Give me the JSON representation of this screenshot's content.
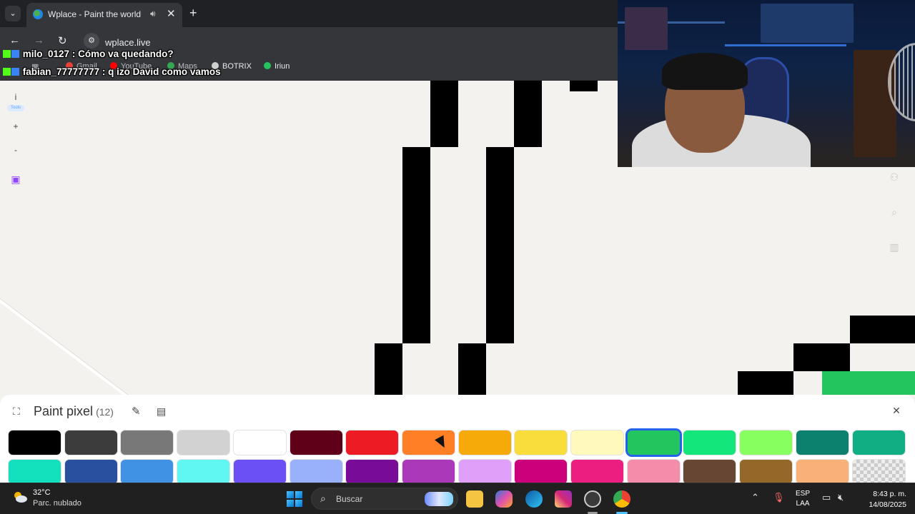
{
  "browser": {
    "tab_title": "Wplace - Paint the world",
    "tab_close": "✕",
    "new_tab": "+",
    "url": "wplace.live",
    "bookmarks": [
      "Gmail",
      "YouTube",
      "Maps",
      "BOTRIX",
      "Iriun"
    ]
  },
  "chat": [
    {
      "user": "milo_0127",
      "message": ": Cómo va quedando?"
    },
    {
      "user": "fabian_77777777",
      "message": ": q izo David como vamos"
    }
  ],
  "tools": {
    "info": "i",
    "info_tag": "Tools",
    "zoom_in": "+",
    "zoom_out": "-"
  },
  "panel": {
    "title": "Paint pixel",
    "count": "(12)",
    "close": "✕",
    "selected_color": "#22c55e",
    "palette_row1": [
      "#000000",
      "#3c3c3c",
      "#787878",
      "#d2d2d2",
      "#ffffff",
      "#600018",
      "#ed1c24",
      "#ff7f27",
      "#f6aa09",
      "#f9dd3b",
      "#fffabc",
      "#22c55e",
      "#13e67b",
      "#87ff5e",
      "#0c816e",
      "#10ae82"
    ],
    "palette_row2": [
      "#13e1be",
      "#28509e",
      "#4093e4",
      "#60f7f2",
      "#6b50f6",
      "#99b1fb",
      "#780c99",
      "#aa38b9",
      "#e09ff9",
      "#cb007a",
      "#ec1f80",
      "#f38da9",
      "#684634",
      "#95682a",
      "#f8b277",
      "transparent"
    ]
  },
  "taskbar": {
    "temperature": "32°C",
    "weather": "Parc. nublado",
    "search_placeholder": "Buscar",
    "lang_line1": "ESP",
    "lang_line2": "LAA",
    "time": "8:43 p. m.",
    "date": "14/08/2025"
  },
  "colors": {
    "chat_user": "#9aff4f",
    "selection_outline": "#2563eb",
    "twitch": "#9146ff"
  }
}
